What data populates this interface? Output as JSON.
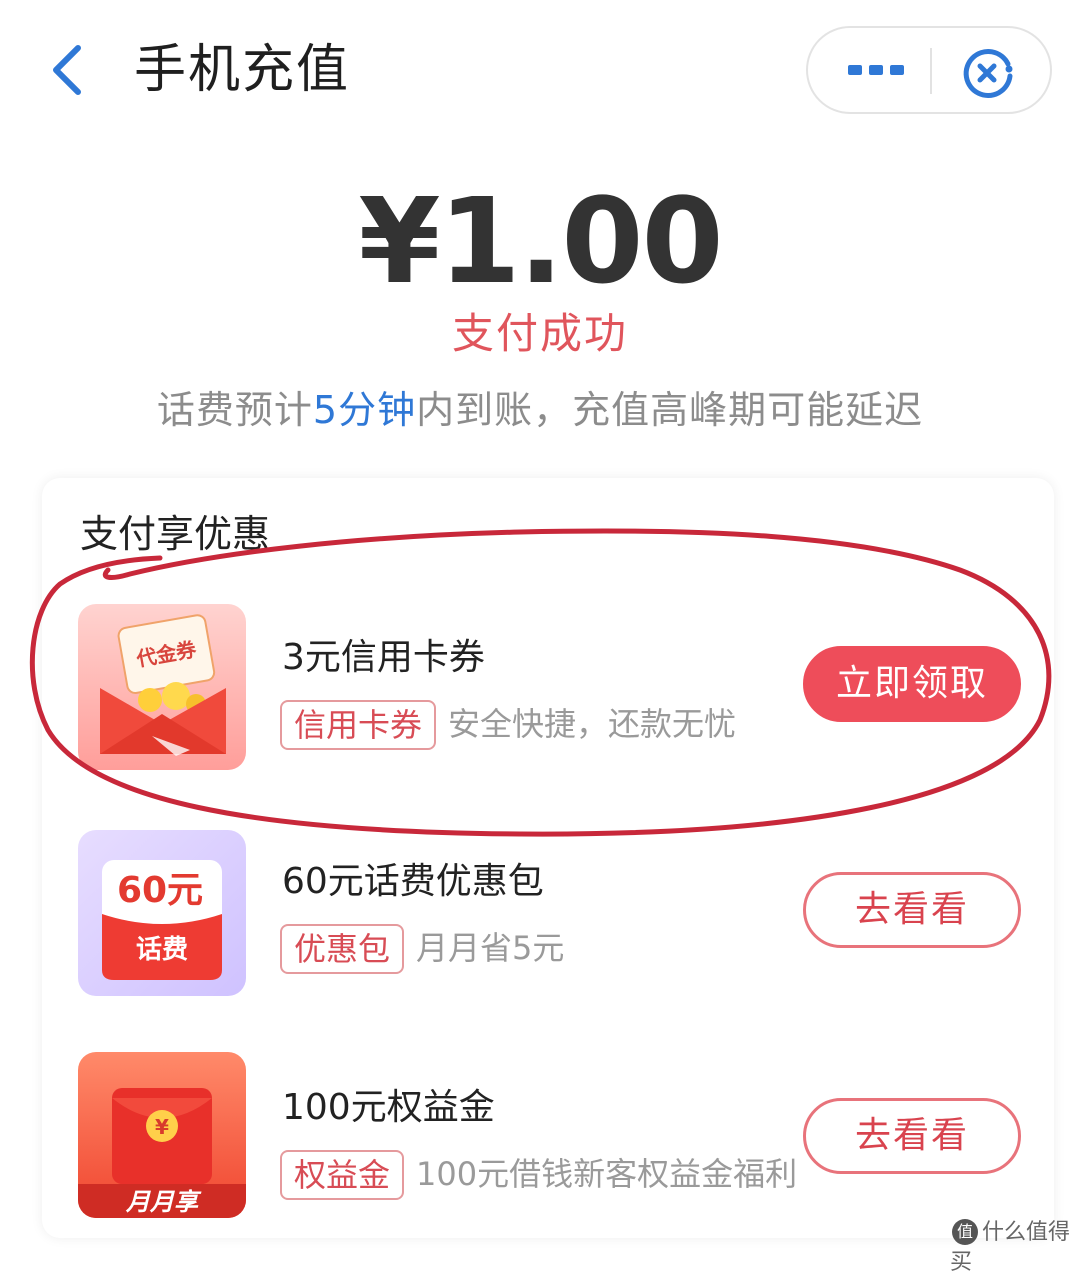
{
  "header": {
    "title": "手机充值"
  },
  "result": {
    "amount": "¥1.00",
    "status": "支付成功",
    "note_before": "话费预计",
    "note_highlight": "5分钟",
    "note_after": "内到账，充值高峰期可能延迟"
  },
  "promotions": {
    "title": "支付享优惠",
    "items": [
      {
        "title": "3元信用卡券",
        "tag": "信用卡券",
        "desc": "安全快捷，还款无忧",
        "button": "立即领取",
        "icon_text": "代金券",
        "icon": "coupon-envelope-icon"
      },
      {
        "title": "60元话费优惠包",
        "tag": "优惠包",
        "desc": "月月省5元",
        "button": "去看看",
        "icon_amount": "60元",
        "icon_text": "话费",
        "icon": "phone-bill-package-icon"
      },
      {
        "title": "100元权益金",
        "tag": "权益金",
        "desc": "100元借钱新客权益金福利",
        "button": "去看看",
        "icon_coin": "¥",
        "icon_text": "月月享",
        "icon": "red-envelope-icon"
      }
    ]
  },
  "watermark": {
    "text": "什么值得买",
    "logo": "值"
  },
  "colors": {
    "accent_red": "#ee4d5a",
    "link_blue": "#2f78d6",
    "annotation_red": "#c8283a"
  }
}
